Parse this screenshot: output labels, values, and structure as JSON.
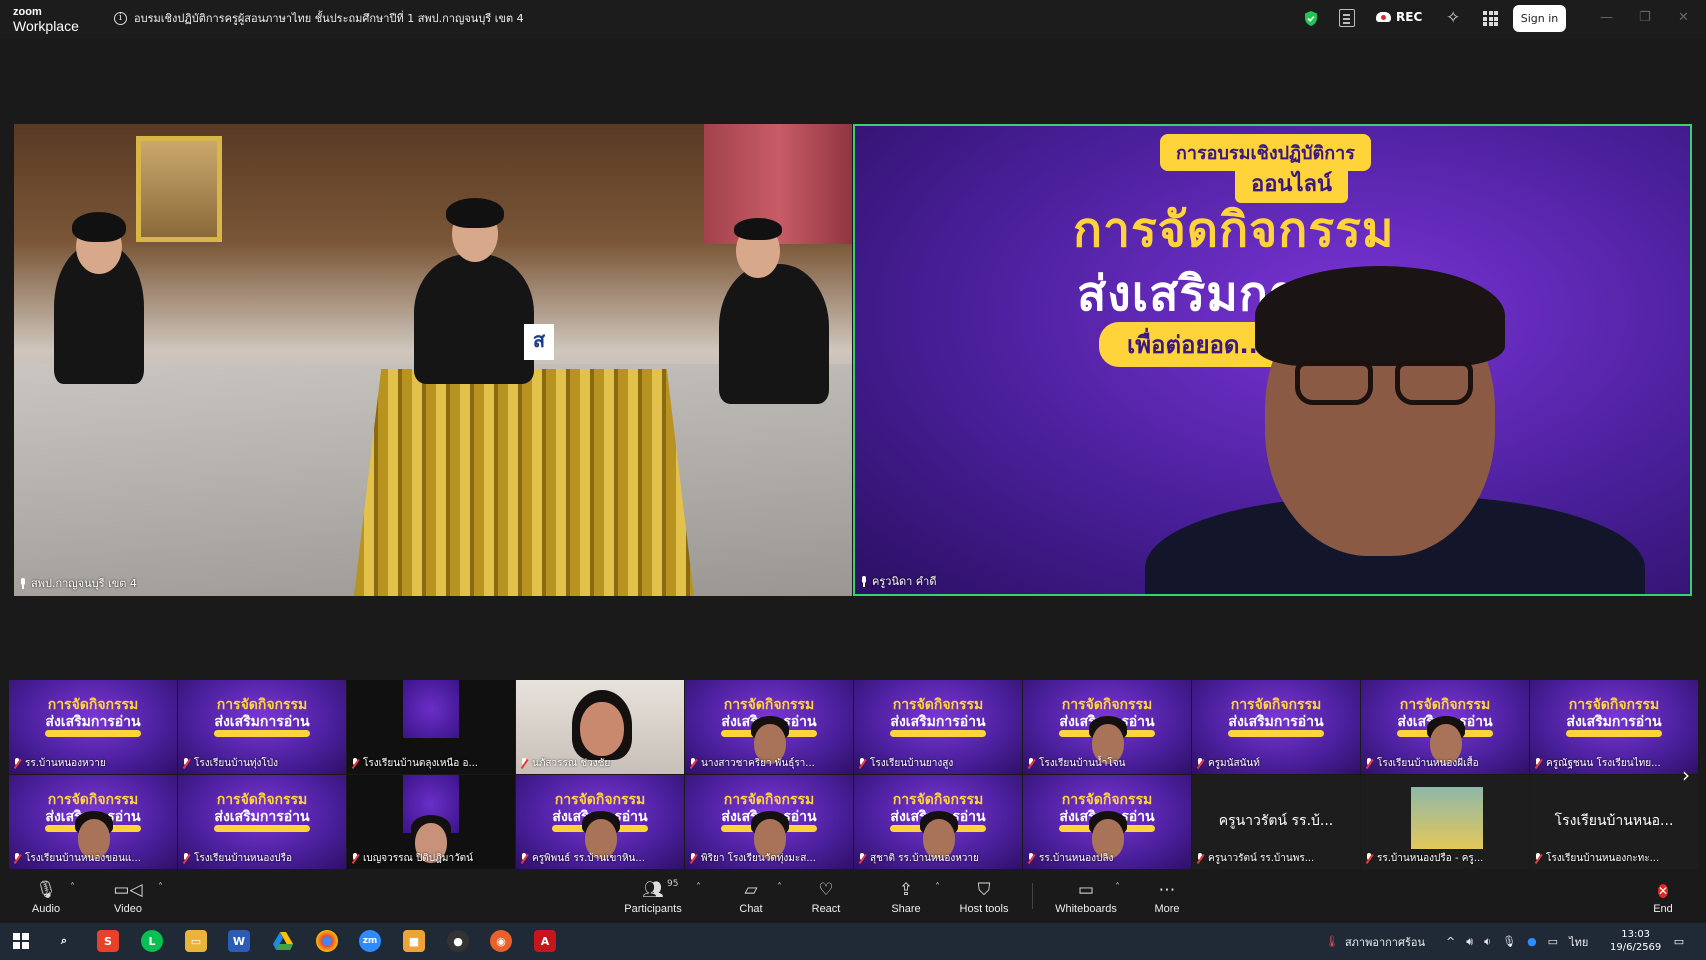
{
  "app": {
    "logo_top": "zoom",
    "logo_bottom": "Workplace",
    "meeting_title": "อบรมเชิงปฏิบัติการครูผู้สอนภาษาไทย ชั้นประถมศึกษาปีที่ 1 สพป.กาญจนบุรี เขต 4",
    "rec_label": "REC",
    "signin_label": "Sign in"
  },
  "stage": {
    "left_tile_name": "สพป.กาญจนบุรี เขต 4",
    "right_tile_name": "ครูวนิดา คำดี",
    "slide": {
      "badge": "การอบรมเชิงปฏิบัติการ",
      "sub": "ออนไลน์",
      "line1": "การจัดกิจกรรม",
      "line2": "ส่งเสริมการอ่าน",
      "line3": "เพื่อต่อยอด...สูงขึ้น"
    },
    "room_placard": "ส"
  },
  "gallery": {
    "slide_title_1": "การจัดกิจกรรม",
    "slide_title_2": "ส่งเสริมการอ่าน",
    "row1": [
      {
        "name": "รร.บ้านหนองหวาย",
        "type": "slide"
      },
      {
        "name": "โรงเรียนบ้านทุ่งโป่ง",
        "type": "slide"
      },
      {
        "name": "โรงเรียนบ้านตลุงเหนือ อ...",
        "type": "dark"
      },
      {
        "name": "นภัสวรรณ ช่วงชัย",
        "type": "camera"
      },
      {
        "name": "นางสาวชาคริยา พันธุ์รา...",
        "type": "slide-face"
      },
      {
        "name": "โรงเรียนบ้านยางสูง",
        "type": "slide"
      },
      {
        "name": "โรงเรียนบ้านน้ำโจน",
        "type": "slide-face"
      },
      {
        "name": "ครูมนัสนันท์",
        "type": "slide"
      },
      {
        "name": "โรงเรียนบ้านหนองผีเสื้อ",
        "type": "slide-face"
      },
      {
        "name": "ครูณัฐชนน โรงเรียนไทย...",
        "type": "slide"
      }
    ],
    "row2": [
      {
        "name": "โรงเรียนบ้านหนองขอนแ...",
        "type": "slide-face"
      },
      {
        "name": "โรงเรียนบ้านหนองปรือ",
        "type": "slide"
      },
      {
        "name": "เบญจวรรณ ปิติปฎิมาวัตน์",
        "type": "dark-face"
      },
      {
        "name": "ครูพิพนธ์ รร.บ้านเขาหิน...",
        "type": "slide-face"
      },
      {
        "name": "พิริยา โรงเรียนวัดทุ่งมะส...",
        "type": "slide-face"
      },
      {
        "name": "สุชาติ รร.บ้านหนองหวาย",
        "type": "slide-face"
      },
      {
        "name": "รร.บ้านหนองปลิง",
        "type": "slide-face"
      },
      {
        "name": "ครูนาวรัตน์ รร.บ้านพร...",
        "type": "namecard",
        "big": "ครูนาวรัตน์ รร.บ้..."
      },
      {
        "name": "รร.บ้านหนองปรือ - ครู...",
        "type": "photo"
      },
      {
        "name": "โรงเรียนบ้านหนองกะทะ...",
        "type": "namecard",
        "big": "โรงเรียนบ้านหนอ..."
      }
    ]
  },
  "toolbar": {
    "audio": "Audio",
    "video": "Video",
    "participants": "Participants",
    "participants_count": "95",
    "chat": "Chat",
    "react": "React",
    "share": "Share",
    "host_tools": "Host tools",
    "whiteboards": "Whiteboards",
    "more": "More",
    "end": "End"
  },
  "taskbar": {
    "weather": "สภาพอากาศร้อน",
    "lang": "ไทย",
    "time": "13:03",
    "date": "19/6/2569"
  }
}
